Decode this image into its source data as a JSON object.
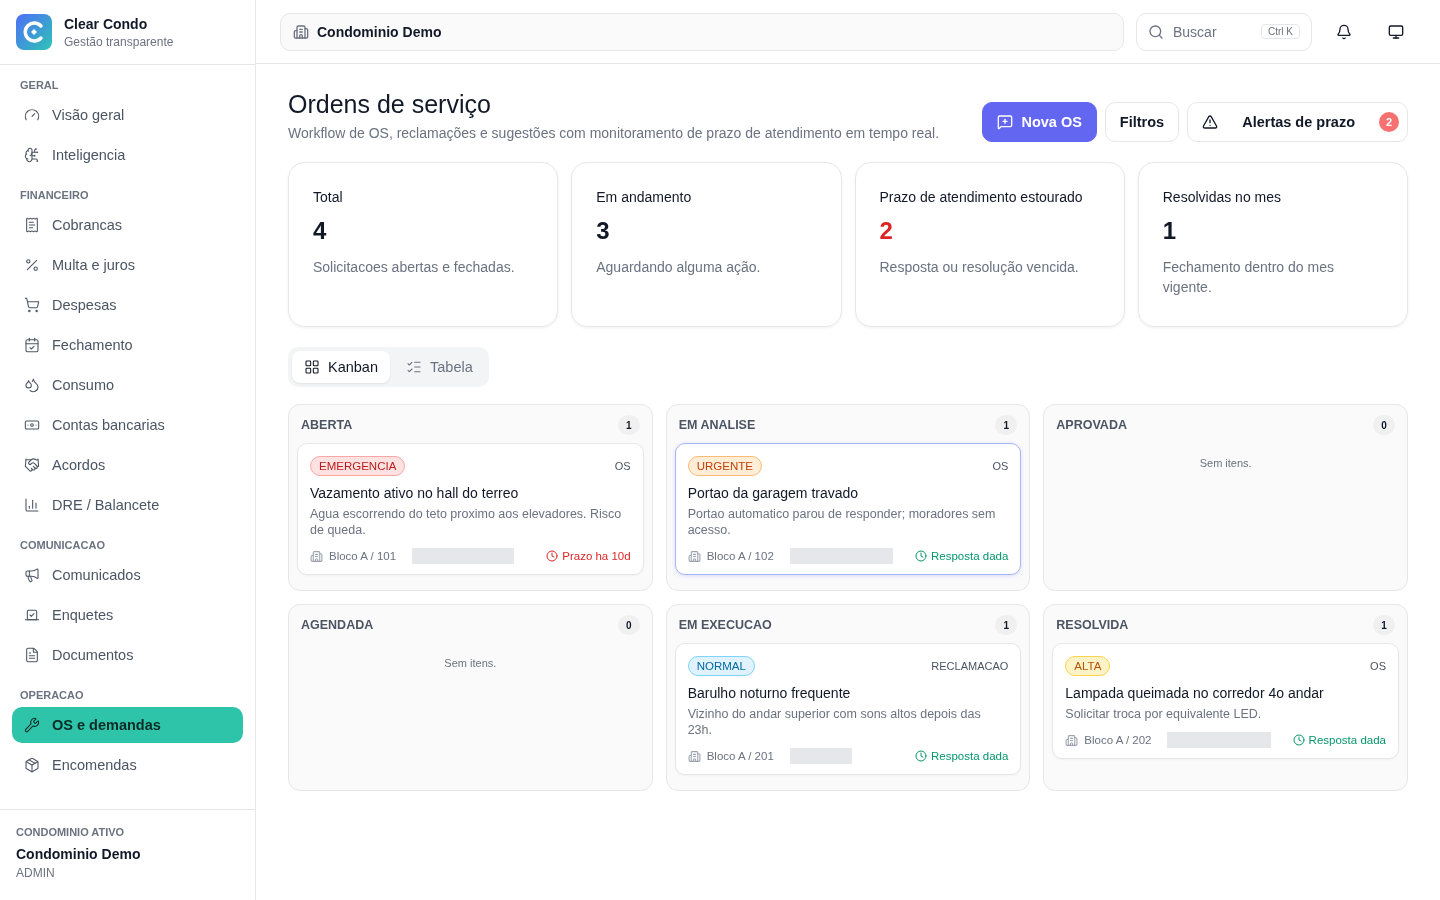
{
  "brand": {
    "name": "Clear Condo",
    "tagline": "Gestão transparente"
  },
  "sidebar": {
    "sections": [
      {
        "title": "GERAL",
        "items": [
          {
            "label": "Visão geral",
            "selected": false
          },
          {
            "label": "Inteligencia",
            "selected": false
          }
        ]
      },
      {
        "title": "FINANCEIRO",
        "items": [
          {
            "label": "Cobrancas",
            "selected": false
          },
          {
            "label": "Multa e juros",
            "selected": false
          },
          {
            "label": "Despesas",
            "selected": false
          },
          {
            "label": "Fechamento",
            "selected": false
          },
          {
            "label": "Consumo",
            "selected": false
          },
          {
            "label": "Contas bancarias",
            "selected": false
          },
          {
            "label": "Acordos",
            "selected": false
          },
          {
            "label": "DRE / Balancete",
            "selected": false
          }
        ]
      },
      {
        "title": "COMUNICACAO",
        "items": [
          {
            "label": "Comunicados",
            "selected": false
          },
          {
            "label": "Enquetes",
            "selected": false
          },
          {
            "label": "Documentos",
            "selected": false
          }
        ]
      },
      {
        "title": "OPERACAO",
        "items": [
          {
            "label": "OS e demandas",
            "selected": true
          },
          {
            "label": "Encomendas",
            "selected": false
          }
        ]
      }
    ],
    "footer": {
      "caption": "CONDOMINIO ATIVO",
      "name": "Condominio Demo",
      "role": "ADMIN"
    }
  },
  "topbar": {
    "condo": "Condominio Demo",
    "search": {
      "placeholder": "Buscar",
      "shortcut": "Ctrl K"
    }
  },
  "page": {
    "title": "Ordens de serviço",
    "subtitle": "Workflow de OS, reclamações e sugestões com monitoramento de prazo de atendimento em tempo real.",
    "actions": {
      "new": "Nova OS",
      "filters": "Filtros",
      "alerts": "Alertas de prazo",
      "alerts_count": "2"
    }
  },
  "stats": [
    {
      "label": "Total",
      "value": "4",
      "note": "Solicitacoes abertas e fechadas.",
      "alert": false
    },
    {
      "label": "Em andamento",
      "value": "3",
      "note": "Aguardando alguma ação.",
      "alert": false
    },
    {
      "label": "Prazo de atendimento estourado",
      "value": "2",
      "note": "Resposta ou resolução vencida.",
      "alert": true
    },
    {
      "label": "Resolvidas no mes",
      "value": "1",
      "note": "Fechamento dentro do mes vigente.",
      "alert": false
    }
  ],
  "view_tabs": [
    {
      "label": "Kanban",
      "selected": true
    },
    {
      "label": "Tabela",
      "selected": false
    }
  ],
  "columns": [
    {
      "title": "ABERTA",
      "count": "1",
      "cards": [
        {
          "priority": "EMERGENCIA",
          "kind": "emergencia",
          "type": "OS",
          "title": "Vazamento ativo no hall do terreo",
          "description": "Agua escorrendo do teto proximo aos elevadores. Risco de queda.",
          "unit": "Bloco A / 101",
          "status": "Prazo ha 10d",
          "overdue": true,
          "selected": false
        }
      ]
    },
    {
      "title": "EM ANALISE",
      "count": "1",
      "cards": [
        {
          "priority": "URGENTE",
          "kind": "urgente",
          "type": "OS",
          "title": "Portao da garagem travado",
          "description": "Portao automatico parou de responder; moradores sem acesso.",
          "unit": "Bloco A / 102",
          "status": "Resposta dada",
          "overdue": false,
          "selected": true
        }
      ]
    },
    {
      "title": "APROVADA",
      "count": "0",
      "empty": "Sem itens."
    },
    {
      "title": "AGENDADA",
      "count": "0",
      "empty": "Sem itens."
    },
    {
      "title": "EM EXECUCAO",
      "count": "1",
      "cards": [
        {
          "priority": "NORMAL",
          "kind": "normal",
          "type": "RECLAMACAO",
          "title": "Barulho noturno frequente",
          "description": "Vizinho do andar superior com sons altos depois das 23h.",
          "unit": "Bloco A / 201",
          "status": "Resposta dada",
          "overdue": false,
          "selected": false
        }
      ]
    },
    {
      "title": "RESOLVIDA",
      "count": "1",
      "cards": [
        {
          "priority": "ALTA",
          "kind": "alta",
          "type": "OS",
          "title": "Lampada queimada no corredor 4o andar",
          "description": "Solicitar troca por equivalente LED.",
          "unit": "Bloco A / 202",
          "status": "Resposta dada",
          "overdue": false,
          "selected": false
        }
      ]
    }
  ]
}
